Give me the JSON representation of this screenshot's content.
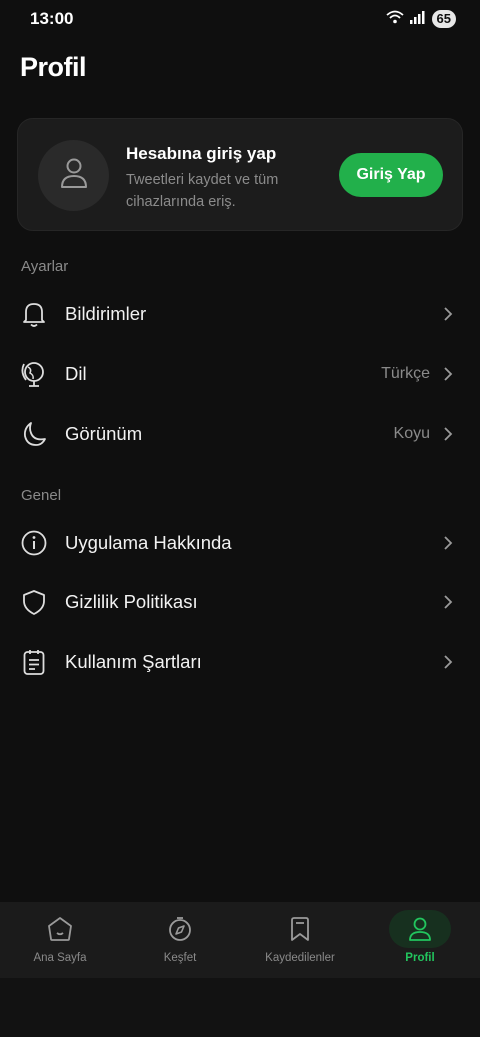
{
  "status_bar": {
    "time": "13:00",
    "battery": "65"
  },
  "header": {
    "title": "Profil"
  },
  "login_card": {
    "title": "Hesabına giriş yap",
    "subtitle": "Tweetleri kaydet ve tüm cihazlarında eriş.",
    "button_label": "Giriş Yap"
  },
  "sections": {
    "settings_label": "Ayarlar",
    "general_label": "Genel"
  },
  "settings_items": [
    {
      "label": "Bildirimler",
      "value": "",
      "icon": "bell-icon"
    },
    {
      "label": "Dil",
      "value": "Türkçe",
      "icon": "globe-icon"
    },
    {
      "label": "Görünüm",
      "value": "Koyu",
      "icon": "moon-icon"
    }
  ],
  "general_items": [
    {
      "label": "Uygulama Hakkında",
      "icon": "info-icon"
    },
    {
      "label": "Gizlilik Politikası",
      "icon": "shield-icon"
    },
    {
      "label": "Kullanım Şartları",
      "icon": "document-icon"
    }
  ],
  "bottom_nav": {
    "items": [
      {
        "label": "Ana Sayfa",
        "icon": "home-icon",
        "active": false
      },
      {
        "label": "Keşfet",
        "icon": "compass-icon",
        "active": false
      },
      {
        "label": "Kaydedilenler",
        "icon": "bookmark-icon",
        "active": false
      },
      {
        "label": "Profil",
        "icon": "user-icon",
        "active": true
      }
    ]
  },
  "colors": {
    "background": "#0f0f0f",
    "accent": "#22b04b",
    "card": "#1c1c1c",
    "muted_text": "#8a8a8a"
  }
}
